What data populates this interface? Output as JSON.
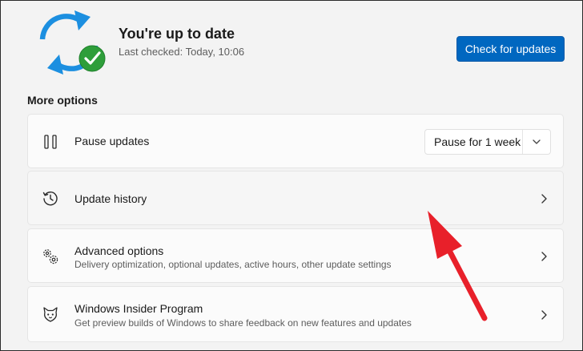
{
  "status": {
    "title": "You're up to date",
    "last_checked": "Last checked: Today, 10:06",
    "icon": "sync-check-icon"
  },
  "actions": {
    "check_updates_label": "Check for updates"
  },
  "more_options": {
    "label": "More options",
    "items": [
      {
        "icon": "pause-icon",
        "title": "Pause updates",
        "control": "dropdown",
        "dropdown_value": "Pause for 1 week"
      },
      {
        "icon": "history-icon",
        "title": "Update history",
        "control": "chevron"
      },
      {
        "icon": "gears-icon",
        "title": "Advanced options",
        "description": "Delivery optimization, optional updates, active hours, other update settings",
        "control": "chevron"
      },
      {
        "icon": "insider-cat-icon",
        "title": "Windows Insider Program",
        "description": "Get preview builds of Windows to share feedback on new features and updates",
        "control": "chevron"
      }
    ]
  },
  "colors": {
    "accent": "#0067c0",
    "sync_blue": "#1c8fe0",
    "check_green": "#2e9e3a",
    "annotation_arrow": "#e8202a",
    "background": "#f3f3f3",
    "card": "#fbfbfb"
  }
}
